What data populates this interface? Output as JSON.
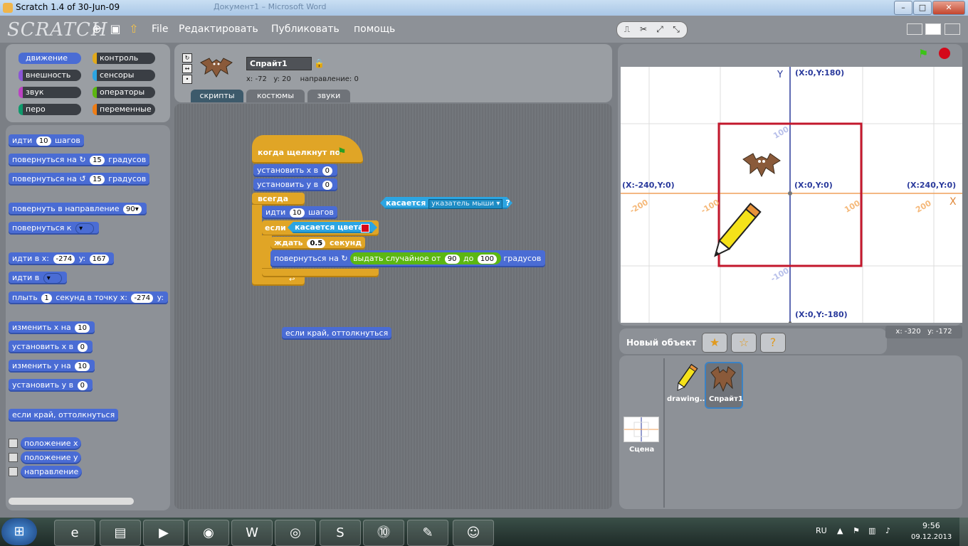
{
  "window": {
    "title": "Scratch 1.4 of 30-Jun-09",
    "background_title": "Документ1 – Microsoft Word",
    "minimize": "–",
    "maximize": "□",
    "close": "✕"
  },
  "app": {
    "logo": "SCRATCH",
    "menu": [
      "File",
      "Редактировать",
      "Публиковать",
      "помощь"
    ],
    "icons": [
      "globe-icon",
      "save-icon",
      "share-icon"
    ],
    "tools": [
      "stamp-tool-icon",
      "cut-tool-icon",
      "grow-tool-icon",
      "shrink-tool-icon"
    ]
  },
  "categories": [
    {
      "label": "движение",
      "color": "#4a6cd4"
    },
    {
      "label": "контроль",
      "color": "#e1a91a"
    },
    {
      "label": "внешность",
      "color": "#8a55d7"
    },
    {
      "label": "сенсоры",
      "color": "#2ca5e2"
    },
    {
      "label": "звук",
      "color": "#bb42c3"
    },
    {
      "label": "операторы",
      "color": "#5cb712"
    },
    {
      "label": "перо",
      "color": "#0e9a6c"
    },
    {
      "label": "переменные",
      "color": "#ee7d16"
    }
  ],
  "palette": {
    "move": "идти",
    "move_steps": "10",
    "move_unit": "шагов",
    "turn_right": "повернуться на",
    "turn_right_val": "15",
    "turn_unit": "градусов",
    "turn_left": "повернуться на",
    "turn_left_val": "15",
    "point_dir": "повернуть в направление",
    "point_dir_val": "90▾",
    "point_to": "повернуться к",
    "goto_xy": "идти в x:",
    "goto_x": "-274",
    "goto_y_label": "y:",
    "goto_y": "167",
    "goto": "идти в",
    "glide": "плыть",
    "glide_secs": "1",
    "glide_rest": "секунд в точку x:",
    "glide_x": "-274",
    "glide_y": "y:",
    "change_x": "изменить x на",
    "change_x_val": "10",
    "set_x": "установить x в",
    "set_x_val": "0",
    "change_y": "изменить y на",
    "change_y_val": "10",
    "set_y": "установить y в",
    "set_y_val": "0",
    "bounce": "если край, оттолкнуться",
    "rep_x": "положение x",
    "rep_y": "положение y",
    "rep_dir": "направление"
  },
  "sprite": {
    "name": "Спрайт1",
    "x_label": "x:",
    "x": "-72",
    "y_label": "y:",
    "y": "20",
    "dir_label": "направление:",
    "dir": "0"
  },
  "tabs": [
    "скрипты",
    "костюмы",
    "звуки"
  ],
  "script": {
    "hat": "когда щелкнут по",
    "set_x": "установить x в",
    "set_x_val": "0",
    "set_y": "установить y в",
    "set_y_val": "0",
    "forever": "всегда",
    "move": "идти",
    "move_val": "10",
    "move_unit": "шагов",
    "if": "если",
    "touching_color": "касается цвета",
    "wait": "ждать",
    "wait_val": "0.5",
    "wait_unit": "секунд",
    "turn": "повернуться на",
    "random": "выдать случайное от",
    "random_from": "90",
    "random_to_label": "до",
    "random_to": "100",
    "turn_unit": "градусов",
    "loose_touching": "касается",
    "loose_touching_val": "указатель мыши ▾",
    "loose_q": "?",
    "loose_bounce": "если край, оттолкнуться"
  },
  "stage": {
    "y_axis": "Y",
    "x_axis": "X",
    "top": "(X:0,Y:180)",
    "bottom": "(X:0,Y:-180)",
    "left": "(X:-240,Y:0)",
    "right": "(X:240,Y:0)",
    "center": "(X:0,Y:0)",
    "ticks": {
      "x_neg200": "-200",
      "x_neg100": "-100",
      "x_100": "100",
      "x_200": "200",
      "y_100": "100",
      "y_neg100": "-100"
    }
  },
  "sprites_bar": {
    "new_sprite": "Новый объект",
    "mouse_x_label": "x:",
    "mouse_x": "-320",
    "mouse_y_label": "y:",
    "mouse_y": "-172"
  },
  "sprite_list": [
    "drawing...",
    "Спрайт1"
  ],
  "stage_thumb": "Сцена",
  "taskbar": {
    "lang": "RU",
    "time": "9:56",
    "date": "09.12.2013",
    "apps": [
      "ie-icon",
      "explorer-icon",
      "media-player-icon",
      "firefox-icon",
      "word-icon",
      "chrome-icon",
      "skype-icon",
      "tv-icon",
      "scanner-icon",
      "scratch-cat-icon"
    ]
  }
}
